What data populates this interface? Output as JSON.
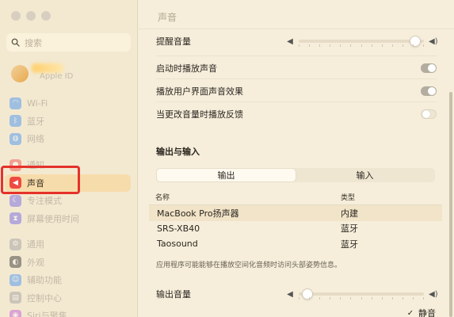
{
  "sidebar": {
    "search_placeholder": "搜索",
    "apple_id_label": "Apple ID",
    "groups": [
      [
        {
          "label": "Wi-Fi",
          "icon": "wifi-icon",
          "color": "#3a8ef5"
        },
        {
          "label": "蓝牙",
          "icon": "bluetooth-icon",
          "color": "#3a8ef5"
        },
        {
          "label": "网络",
          "icon": "globe-icon",
          "color": "#3a8ef5"
        }
      ],
      [
        {
          "label": "通知",
          "icon": "bell-icon",
          "color": "#ef4a42"
        },
        {
          "label": "声音",
          "icon": "speaker-icon",
          "color": "#ef4a42",
          "active": true
        },
        {
          "label": "专注模式",
          "icon": "moon-icon",
          "color": "#6c5ce7"
        },
        {
          "label": "屏幕使用时间",
          "icon": "hourglass-icon",
          "color": "#6c5ce7"
        }
      ],
      [
        {
          "label": "通用",
          "icon": "gear-icon",
          "color": "#9a9a9a"
        },
        {
          "label": "外观",
          "icon": "appearance-icon",
          "color": "#2b2b2b"
        },
        {
          "label": "辅助功能",
          "icon": "accessibility-icon",
          "color": "#3a8ef5"
        },
        {
          "label": "控制中心",
          "icon": "control-center-icon",
          "color": "#9a9a9a"
        },
        {
          "label": "Siri与聚焦",
          "icon": "siri-icon",
          "color": "#c04fd8"
        }
      ]
    ]
  },
  "main": {
    "title": "声音",
    "alert_volume_label": "提醒音量",
    "alert_volume_level": 0.97,
    "startup_sound_label": "启动时播放声音",
    "startup_sound_on": true,
    "ui_sound_label": "播放用户界面声音效果",
    "ui_sound_on": true,
    "feedback_label": "当更改音量时播放反馈",
    "feedback_on": false,
    "io_section_title": "输出与输入",
    "tabs": [
      "输出",
      "输入"
    ],
    "selected_tab": 0,
    "table": {
      "headers": [
        "名称",
        "类型"
      ],
      "rows": [
        {
          "name": "MacBook Pro扬声器",
          "type": "内建",
          "selected": true
        },
        {
          "name": "SRS-XB40",
          "type": "蓝牙",
          "selected": false
        },
        {
          "name": "Taosound",
          "type": "蓝牙",
          "selected": false
        }
      ]
    },
    "footnote": "应用程序可能能够在播放空间化音频时访问头部姿势信息。",
    "output_volume_label": "输出音量",
    "output_volume_level": 0.03,
    "mute_label": "静音",
    "mute_checked": true
  }
}
